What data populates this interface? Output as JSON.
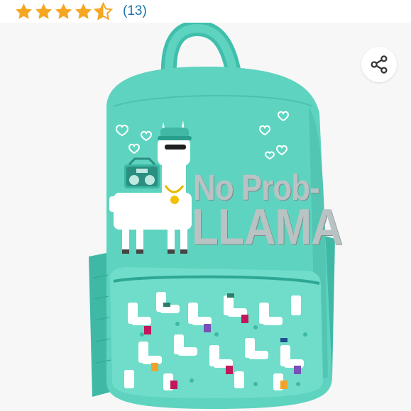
{
  "rating": {
    "value": 4.5,
    "max": 5,
    "count_label": "(13)",
    "star_color": "#f5a623"
  },
  "share": {
    "icon": "share-icon"
  },
  "product_image": {
    "print_line1": "No Prob-",
    "print_line2": "LLAMA",
    "backpack_color": "#5ed3bf",
    "background_color": "#f7f7f7"
  }
}
